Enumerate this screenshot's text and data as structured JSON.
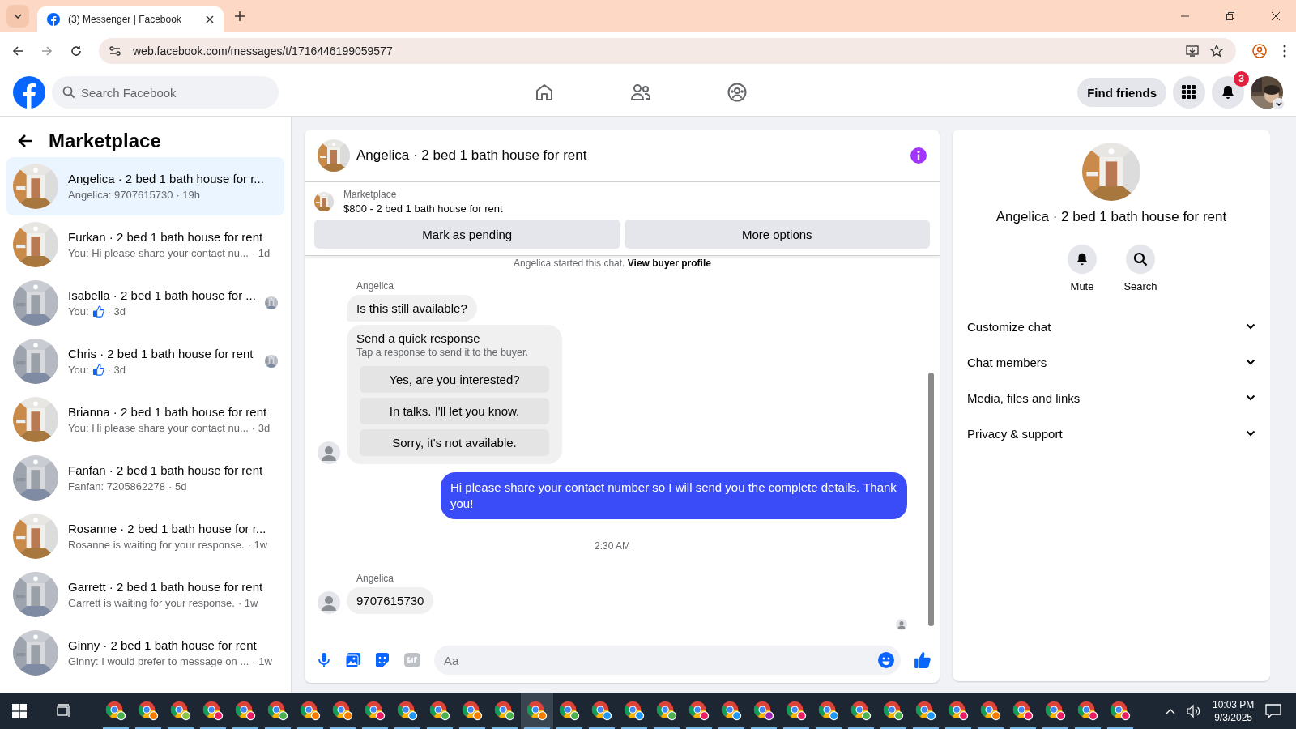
{
  "browser": {
    "tab_title": "(3) Messenger | Facebook",
    "url": "web.facebook.com/messages/t/1716446199059577"
  },
  "topbar": {
    "search_placeholder": "Search Facebook",
    "find_friends": "Find friends",
    "notification_count": "3"
  },
  "sidebar": {
    "title": "Marketplace",
    "conversations": [
      {
        "title": "Angelica · 2 bed 1 bath house for r...",
        "preview": "Angelica: 9707615730",
        "like": false,
        "time": "· 19h",
        "seen": false,
        "selected": true
      },
      {
        "title": "Furkan · 2 bed 1 bath house for rent",
        "preview": "You: Hi please share your contact nu...",
        "like": false,
        "time": "· 1d",
        "seen": false,
        "selected": false
      },
      {
        "title": "Isabella · 2 bed 1 bath house for ...",
        "preview": "You:",
        "like": true,
        "time": "· 3d",
        "seen": true,
        "selected": false
      },
      {
        "title": "Chris · 2 bed 1 bath house for rent",
        "preview": "You:",
        "like": true,
        "time": "· 3d",
        "seen": true,
        "selected": false
      },
      {
        "title": "Brianna · 2 bed 1 bath house for rent",
        "preview": "You: Hi please share your contact nu...",
        "like": false,
        "time": "· 3d",
        "seen": false,
        "selected": false
      },
      {
        "title": "Fanfan · 2 bed 1 bath house for rent",
        "preview": "Fanfan: 7205862278",
        "like": false,
        "time": "· 5d",
        "seen": false,
        "selected": false
      },
      {
        "title": "Rosanne · 2 bed 1 bath house for r...",
        "preview": "Rosanne is waiting for your response.",
        "like": false,
        "time": "· 1w",
        "seen": false,
        "selected": false
      },
      {
        "title": "Garrett · 2 bed 1 bath house for rent",
        "preview": "Garrett is waiting for your response.",
        "like": false,
        "time": "· 1w",
        "seen": false,
        "selected": false
      },
      {
        "title": "Ginny · 2 bed 1 bath house for rent",
        "preview": "Ginny: I would prefer to message on ...",
        "like": false,
        "time": "· 1w",
        "seen": false,
        "selected": false
      }
    ]
  },
  "chat": {
    "title": "Angelica · 2 bed 1 bath house for rent",
    "listing_label": "Marketplace",
    "listing": "$800 - 2 bed 1 bath house for rent",
    "actions": [
      "Mark as pending",
      "More options"
    ],
    "started": "Angelica started this chat.",
    "started_link": "View buyer profile",
    "messages": [
      {
        "kind": "incoming",
        "sender": "Angelica",
        "text": "Is this still available?",
        "avatar": false
      },
      {
        "kind": "quick",
        "title": "Send a quick response",
        "subtitle": "Tap a response to send it to the buyer.",
        "options": [
          "Yes, are you interested?",
          "In talks. I'll let you know.",
          "Sorry, it's not available."
        ],
        "avatar": true
      },
      {
        "kind": "outgoing",
        "text": "Hi please share your contact number so I will send you the complete details. Thank you!"
      },
      {
        "kind": "time",
        "text": "2:30 AM"
      },
      {
        "kind": "incoming",
        "sender": "Angelica",
        "text": "9707615730",
        "avatar": true
      }
    ],
    "composer_placeholder": "Aa"
  },
  "details": {
    "title": "Angelica · 2 bed 1 bath house for rent",
    "actions": [
      "Mute",
      "Search"
    ],
    "sections": [
      "Customize chat",
      "Chat members",
      "Media, files and links",
      "Privacy & support"
    ]
  },
  "taskbar": {
    "time": "10:03 PM",
    "date": "9/3/2025",
    "apps": [
      {
        "color": "#4caf50",
        "selected": false
      },
      {
        "color": "#f57c00",
        "selected": false
      },
      {
        "color": "#8bc34a",
        "selected": false
      },
      {
        "color": "#e91e63",
        "selected": false
      },
      {
        "color": "#e91e63",
        "selected": false
      },
      {
        "color": "#4caf50",
        "selected": false
      },
      {
        "color": "#f57c00",
        "selected": false
      },
      {
        "color": "#f57c00",
        "selected": false
      },
      {
        "color": "#e91e63",
        "selected": false
      },
      {
        "color": "#2196f3",
        "selected": false
      },
      {
        "color": "#4caf50",
        "selected": false
      },
      {
        "color": "#f57c00",
        "selected": false
      },
      {
        "color": "#4caf50",
        "selected": false
      },
      {
        "color": "#f57c00",
        "selected": true
      },
      {
        "color": "#4caf50",
        "selected": false
      },
      {
        "color": "#2196f3",
        "selected": false
      },
      {
        "color": "#2196f3",
        "selected": false
      },
      {
        "color": "#4caf50",
        "selected": false
      },
      {
        "color": "#e91e63",
        "selected": false
      },
      {
        "color": "#2196f3",
        "selected": false
      },
      {
        "color": "#9c27b0",
        "selected": false
      },
      {
        "color": "#e91e63",
        "selected": false
      },
      {
        "color": "#2196f3",
        "selected": false
      },
      {
        "color": "#4caf50",
        "selected": false
      },
      {
        "color": "#4caf50",
        "selected": false
      },
      {
        "color": "#2196f3",
        "selected": false
      },
      {
        "color": "#e91e63",
        "selected": false
      },
      {
        "color": "#f57c00",
        "selected": false
      },
      {
        "color": "#e91e63",
        "selected": false
      },
      {
        "color": "#e91e63",
        "selected": false
      },
      {
        "color": "#e91e63",
        "selected": false
      },
      {
        "color": "#e91e63",
        "selected": false
      }
    ]
  }
}
